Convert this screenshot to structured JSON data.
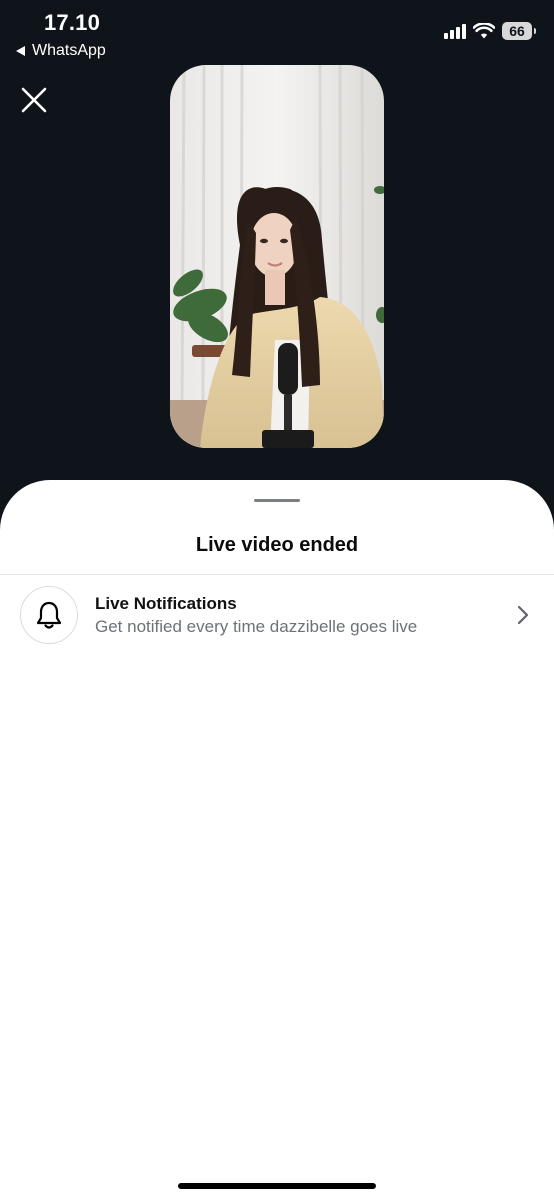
{
  "status_bar": {
    "time": "17.10",
    "back_app": "WhatsApp",
    "battery_level": "66",
    "icons": [
      "signal-icon",
      "wifi-icon",
      "battery-icon"
    ]
  },
  "header": {
    "close_icon": "close-icon"
  },
  "video_preview": {
    "description_icon": "live-video-thumbnail"
  },
  "sheet": {
    "title": "Live video ended",
    "notification": {
      "icon": "bell-icon",
      "title": "Live Notifications",
      "subtitle": "Get notified every time dazzibelle goes live",
      "chevron_icon": "chevron-right-icon"
    }
  },
  "colors": {
    "background": "#0e1419",
    "sheet": "#ffffff",
    "subtitle": "#6d7278",
    "divider": "#e4e6e8"
  }
}
